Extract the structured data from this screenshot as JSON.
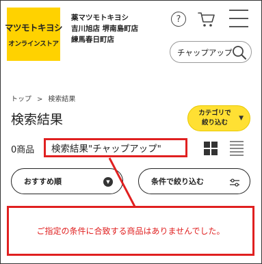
{
  "header": {
    "logo_main": "マツモトキヨシ",
    "logo_sub": "オンラインストア",
    "store_lines": [
      "薬マツモトキヨシ",
      "吉川旭店 堺南島町店",
      "練馬春日町店"
    ],
    "help_glyph": "?"
  },
  "search": {
    "value": "チャップアップ"
  },
  "breadcrumb": {
    "home": "トップ",
    "separator": ">",
    "current": "検索結果"
  },
  "page": {
    "title": "検索結果",
    "category_button": "カテゴリで 絞り込む",
    "count": "0商品",
    "query": "検索結果\"チャップアップ\"",
    "sort_label": "おすすめ順",
    "filter_label": "条件で絞り込む",
    "no_results": "ご指定の条件に合致する商品はありませんでした。"
  },
  "colors": {
    "brand_yellow": "#ffd200",
    "button_yellow": "#ffe033",
    "highlight_red": "#e02020"
  }
}
